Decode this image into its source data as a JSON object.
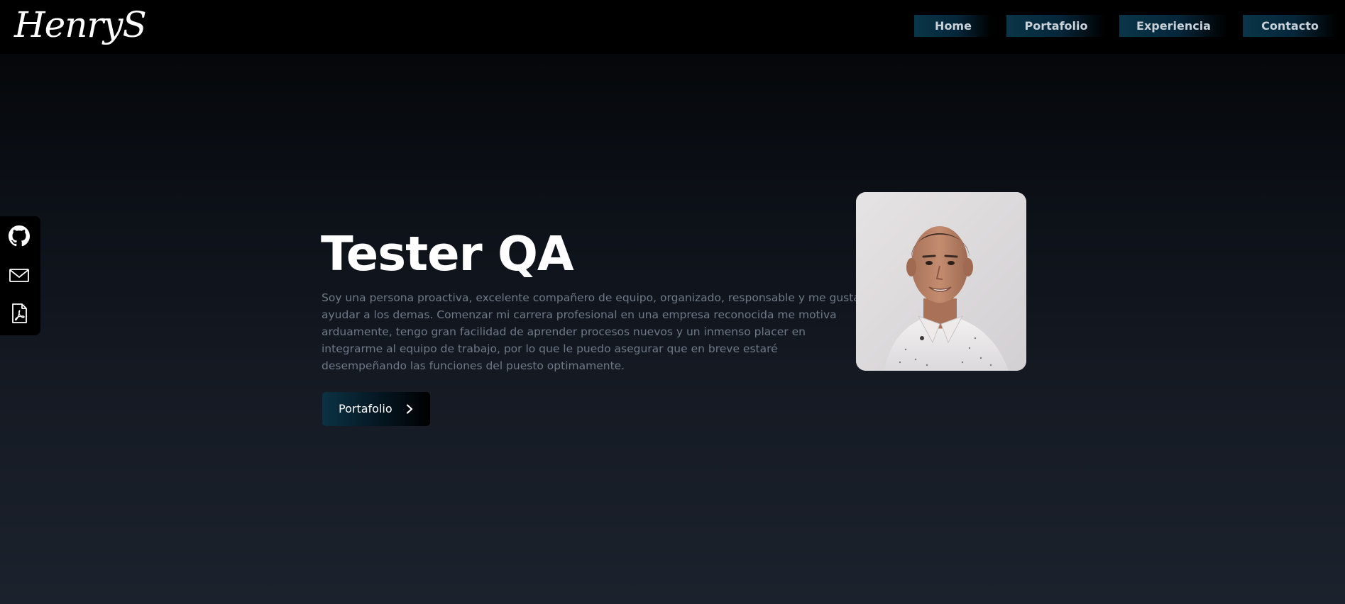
{
  "header": {
    "logo_text": "HenryS",
    "nav": [
      {
        "label": "Home"
      },
      {
        "label": "Portafolio"
      },
      {
        "label": "Experiencia"
      },
      {
        "label": "Contacto"
      }
    ]
  },
  "social": {
    "items": [
      {
        "icon": "github-icon"
      },
      {
        "icon": "mail-icon"
      },
      {
        "icon": "pdf-icon"
      }
    ]
  },
  "hero": {
    "title": "Tester QA",
    "bio": "Soy una persona proactiva, excelente compañero de equipo, organizado, responsable y me gusta ayudar a los demas. Comenzar mi carrera profesional en una empresa reconocida me motiva arduamente, tengo gran facilidad de aprender procesos nuevos y un inmenso placer en integrarme al equipo de trabajo, por lo que le puedo asegurar que en breve estaré desempeñando las funciones del puesto optimamente.",
    "cta_label": "Portafolio",
    "cta_icon": "chevron-right-icon"
  },
  "colors": {
    "nav_accent": "#0a3548",
    "text_muted": "#6f7987",
    "heading": "#ffffff"
  }
}
